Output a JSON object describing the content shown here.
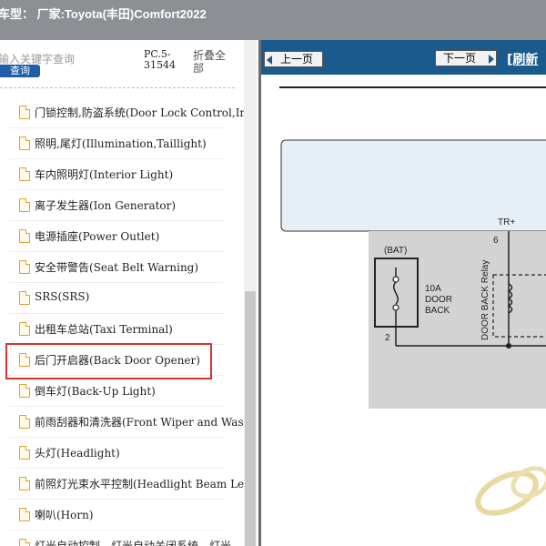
{
  "titlebar": {
    "title": "车型： 厂家:Toyota(丰田)Comfort2022"
  },
  "left_panel": {
    "search": {
      "placeholder": "输入关键字查询",
      "button_label": "查询"
    },
    "pc_code": "PC.5-31544",
    "collapse_label": "折叠全部",
    "items": [
      {
        "label": "门锁控制,防盗系统(Door Lock Control,Im"
      },
      {
        "label": "照明,尾灯(Illumination,Taillight)"
      },
      {
        "label": "车内照明灯(Interior Light)"
      },
      {
        "label": "离子发生器(Ion Generator)"
      },
      {
        "label": "电源插座(Power Outlet)"
      },
      {
        "label": "安全带警告(Seat Belt Warning)"
      },
      {
        "label": "SRS(SRS)"
      },
      {
        "label": "出租车总站(Taxi Terminal)"
      },
      {
        "label": "后门开启器(Back Door Opener)",
        "highlighted": true
      },
      {
        "label": "倒车灯(Back-Up Light)"
      },
      {
        "label": "前雨刮器和清洗器(Front Wiper and Washe"
      },
      {
        "label": "头灯(Headlight)"
      },
      {
        "label": "前照灯光束水平控制(Headlight Beam Lev"
      },
      {
        "label": "喇叭(Horn)"
      },
      {
        "label": "灯光自动控制，灯光自动关闭系统，灯光"
      }
    ]
  },
  "right_panel": {
    "prev_label": "上一页",
    "next_label": "下一页",
    "refresh_label": "[刷新"
  },
  "diagram": {
    "labels": {
      "bat": "(BAT)",
      "trplus": "TR+",
      "pin6": "6",
      "pin2": "2",
      "fuse_line1": "10A",
      "fuse_line2": "DOOR",
      "fuse_line3": "BACK",
      "relay": "DOOR BACK Relay"
    },
    "colors": {
      "fill": "#d3d3d3",
      "line": "#222222",
      "box_fill": "#e6eef6",
      "box_stroke": "#333333"
    }
  },
  "colors": {
    "titlebar": "#8c8f94",
    "header": "#1a5a8c",
    "highlight": "#d9322c",
    "search_button": "#1f5fa8"
  }
}
